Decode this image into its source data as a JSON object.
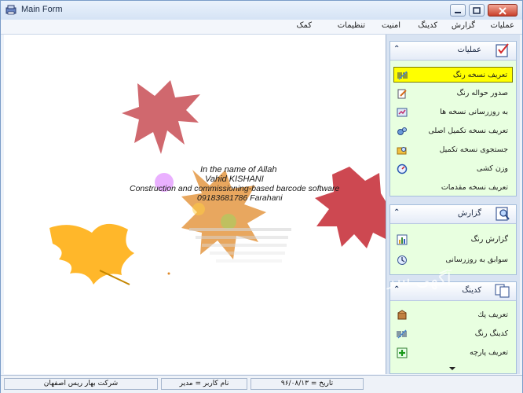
{
  "window": {
    "title": "Main Form"
  },
  "menu": [
    {
      "label": "عملیات"
    },
    {
      "label": "گزارش"
    },
    {
      "label": "کدینگ"
    },
    {
      "label": "امنیت"
    },
    {
      "label": "تنظیمات"
    },
    {
      "label": "کمک"
    }
  ],
  "splash": {
    "line1": "In the name of Allah",
    "line2": "Vahid KISHANI",
    "line3": "Construction and commissioning-based barcode software",
    "line4": "09183681786 Farahani"
  },
  "panels": {
    "operations": {
      "title": "عملیات",
      "items": [
        {
          "label": "تعریف نسخه رنگ",
          "icon": "barcode-icon"
        },
        {
          "label": "صدور حواله رنگ",
          "icon": "document-pen-icon"
        },
        {
          "label": "به روزرسانی نسخه ها",
          "icon": "update-icon"
        },
        {
          "label": "تعریف نسخه تکمیل اصلی",
          "icon": "gears-icon"
        },
        {
          "label": "جستجوی نسخه تکمیل",
          "icon": "search-folder-icon"
        },
        {
          "label": "وزن کشی",
          "icon": "scale-icon"
        },
        {
          "label": "تعریف نسخه مقدمات",
          "icon": ""
        }
      ]
    },
    "report": {
      "title": "گزارش",
      "items": [
        {
          "label": "گزارش  رنگ",
          "icon": "report-chart-icon"
        },
        {
          "label": "سوابق به روزرسانی",
          "icon": "history-icon"
        }
      ]
    },
    "coding": {
      "title": "کدینگ",
      "items": [
        {
          "label": "تعریف پك",
          "icon": "package-icon"
        },
        {
          "label": "کدینگ رنگ",
          "icon": "barcode-icon"
        },
        {
          "label": "تعریف پارچه",
          "icon": "add-fabric-icon"
        }
      ]
    }
  },
  "watermark": "آگهی سرا",
  "status": {
    "date": "تاریخ = ۹۶/۰۸/۱۳",
    "user": "نام کاربر = مدیر",
    "company": "شرکت بهار ریس اصفهان"
  },
  "colors": {
    "selected": "#ffff00",
    "panel": "#e8ffe0",
    "chrome": "#d8e3f2"
  }
}
